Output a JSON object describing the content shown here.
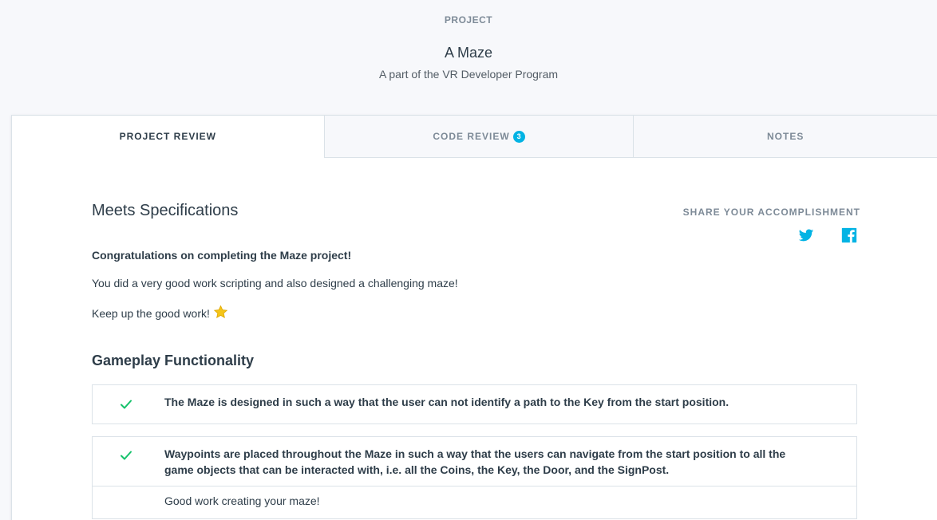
{
  "header": {
    "eyebrow": "PROJECT",
    "title": "A Maze",
    "subtitle": "A part of the VR Developer Program"
  },
  "tabs": [
    {
      "label": "PROJECT REVIEW",
      "active": true
    },
    {
      "label": "CODE REVIEW",
      "badge": "3",
      "active": false
    },
    {
      "label": "NOTES",
      "active": false
    }
  ],
  "review": {
    "status": "Meets Specifications",
    "share_label": "SHARE YOUR ACCOMPLISHMENT",
    "share_icons": [
      "twitter-icon",
      "facebook-icon"
    ],
    "messages": [
      "Congratulations on completing the Maze project!",
      "You did a very good work scripting and also designed a challenging maze!",
      "Keep up the good work!"
    ],
    "message_emoji": "star-icon"
  },
  "section": {
    "title": "Gameplay Functionality",
    "criteria": [
      {
        "text": "The Maze is designed in such a way that the user can not identify a path to the Key from the start position.",
        "met": true
      },
      {
        "text": "Waypoints are placed throughout the Maze in such a way that the users can navigate from the start position to all the game objects that can be interacted with, i.e. all the Coins, the Key, the Door, and the SignPost.",
        "met": true,
        "comment": "Good work creating your maze!"
      }
    ]
  },
  "colors": {
    "accent": "#02b3e4",
    "check": "#15c26b",
    "text": "#2e3d49",
    "muted": "#7d8a97",
    "page_bg": "#f7f8fb",
    "border": "#dbe2e8",
    "star": "#f5c518"
  }
}
